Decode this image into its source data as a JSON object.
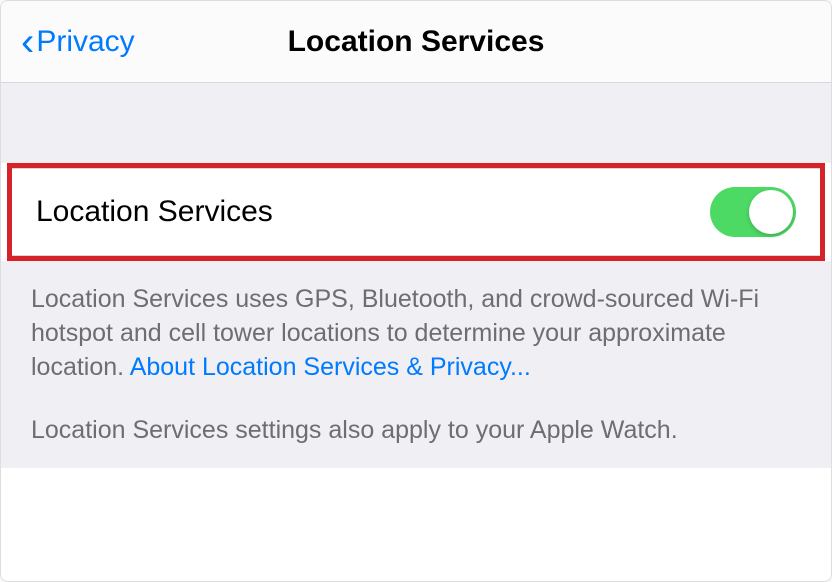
{
  "nav": {
    "back_label": "Privacy",
    "title": "Location Services"
  },
  "setting": {
    "label": "Location Services",
    "enabled": true
  },
  "description": {
    "main_text": "Location Services uses GPS, Bluetooth, and crowd-sourced Wi-Fi hotspot and cell tower locations to determine your approximate location. ",
    "link_text": "About Location Services & Privacy...",
    "secondary_text": "Location Services settings also apply to your Apple Watch."
  },
  "colors": {
    "link": "#007aff",
    "toggle_on": "#4cd964",
    "highlight": "#d6232a"
  }
}
